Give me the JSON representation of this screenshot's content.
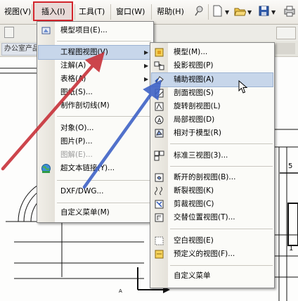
{
  "menubar": {
    "items": [
      "视图(V)",
      "插入(I)",
      "工具(T)",
      "窗口(W)",
      "帮助(H)"
    ],
    "active_index": 1
  },
  "toolbar": {
    "icons": [
      "pin-icon",
      "new-document-icon",
      "open-folder-icon",
      "save-icon",
      "print-icon"
    ]
  },
  "left_tab": {
    "label": "办公室产品"
  },
  "insert_menu": {
    "items": [
      {
        "label": "模型项目(E)...",
        "icon": "model-items-icon"
      },
      {
        "label": "工程图视图(V)",
        "submenu": true,
        "highlighted": true
      },
      {
        "label": "注解(A)",
        "submenu": true
      },
      {
        "label": "表格(A)",
        "submenu": true
      },
      {
        "label": "图纸(S)..."
      },
      {
        "label": "制作剖切线(M)"
      },
      {
        "label": "对象(O)..."
      },
      {
        "label": "图片(P)..."
      },
      {
        "label": "图解(E)...",
        "disabled": true
      },
      {
        "label": "超文本链接(Y)...",
        "icon": "hyperlink-globe-icon"
      },
      {
        "label": "DXF/DWG..."
      },
      {
        "label": "自定义菜单(M)"
      }
    ]
  },
  "drawing_view_submenu": {
    "items": [
      {
        "label": "模型(M)...",
        "icon": "model-view-icon"
      },
      {
        "label": "投影视图(P)",
        "icon": "projected-view-icon"
      },
      {
        "label": "辅助视图(A)",
        "icon": "auxiliary-view-icon",
        "highlighted": true
      },
      {
        "label": "剖面视图(S)",
        "icon": "section-view-icon"
      },
      {
        "label": "旋转剖视图(L)",
        "icon": "aligned-section-icon"
      },
      {
        "label": "局部视图(D)",
        "icon": "detail-view-icon"
      },
      {
        "label": "相对于模型(R)",
        "icon": "relative-view-icon"
      },
      {
        "label": "标准三视图(3)...",
        "icon": "standard-3-view-icon"
      },
      {
        "label": "断开的剖视图(B)...",
        "icon": "broken-out-section-icon"
      },
      {
        "label": "断裂视图(K)",
        "icon": "break-view-icon"
      },
      {
        "label": "剪裁视图(C)",
        "icon": "crop-view-icon"
      },
      {
        "label": "交替位置视图(T)...",
        "icon": "alternate-position-icon"
      },
      {
        "label": "空白视图(E)",
        "icon": "empty-view-icon"
      },
      {
        "label": "预定义的视图(F)...",
        "icon": "predefined-view-icon"
      },
      {
        "label": "自定义菜单"
      }
    ]
  },
  "drawing_labels": {
    "dim_top": "5",
    "dim_bottom": "1",
    "corner_mark": "A"
  },
  "colors": {
    "highlight_box": "#d3242c",
    "menu_highlight": "#c7d6ea",
    "arrow_red": "#c8323a",
    "arrow_blue": "#3f63c7"
  }
}
